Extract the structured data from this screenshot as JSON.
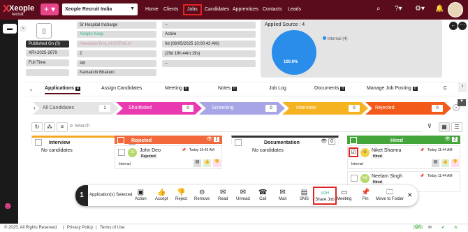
{
  "header": {
    "brand": "Xeople",
    "brand_sub": "recruit",
    "org": "Xeople Recruit India",
    "nav": [
      "Home",
      "Clients",
      "Jobs",
      "Candidates",
      "Apprentices",
      "Contacts",
      "Leads"
    ],
    "active_nav": "Jobs"
  },
  "job": {
    "published": "Published On (0)",
    "job_id": "XRI-2025-2679",
    "type": "Full Time",
    "fields_mid": [
      "Sr Hospital Incharge",
      "Xeople Keep",
      "Newstate/Test, AUSTRALIA",
      "2",
      "AB",
      "Kamakshi Bhakuni"
    ],
    "fields_right": [
      "--",
      "Active",
      "0d (08/05/2025 10:00:43 AM)",
      "(29d 19h:44m:19s)",
      "--"
    ]
  },
  "chart": {
    "title": "Applied Source : 4",
    "legend": "Internal (4)",
    "value_label": "100.0%"
  },
  "tabs": [
    {
      "label": "Applications",
      "badge": "4"
    },
    {
      "label": "Assign Candidates"
    },
    {
      "label": "Meeting",
      "badge": "0"
    },
    {
      "label": "Notes",
      "badge": "0"
    },
    {
      "label": "Job Log"
    },
    {
      "label": "Documents",
      "badge": "0"
    },
    {
      "label": "Manage Job Posting",
      "badge": "0"
    },
    {
      "label": "C"
    }
  ],
  "stages": [
    {
      "label": "All Candidates",
      "count": "1",
      "color": "#e5e5e5",
      "text": "#555"
    },
    {
      "label": "Shortlisted",
      "count": "0",
      "color": "#ea3ab2",
      "text": "#fff"
    },
    {
      "label": "Screening",
      "count": "0",
      "color": "#a7a5e6",
      "text": "#fff"
    },
    {
      "label": "Interview",
      "count": "0",
      "color": "#f5b322",
      "text": "#fff"
    },
    {
      "label": "Rejected",
      "count": "0",
      "color": "#f25a19",
      "text": "#fff"
    }
  ],
  "search": {
    "placeholder": "Search"
  },
  "columns": [
    {
      "title": "Interview",
      "count": "0",
      "color": "#f5a623",
      "empty": "No candidates"
    },
    {
      "title": "Rejected",
      "count": "1",
      "color": "#f1693b",
      "cards": [
        {
          "initials": "JD",
          "name": "John Deo",
          "time": "Today 10:45 AM",
          "status": "Rejected",
          "source": "Internal"
        }
      ]
    },
    {
      "title": "Documentation",
      "count": "0",
      "color": "#333",
      "empty": "No candidates"
    },
    {
      "title": "Hired",
      "count": "2",
      "color": "#43a53a",
      "cards": [
        {
          "initials": "",
          "name": "Niket Sharma",
          "time": "Today 11:44 AM",
          "status": "Hired",
          "source": "Internal"
        },
        {
          "initials": "NS",
          "name": "Neelam Singh",
          "time": "Today 11:44 AM",
          "status": "Hired",
          "source": "Internal"
        }
      ]
    }
  ],
  "bulk": {
    "count": "1",
    "label": "Application(s) Selected",
    "actions": [
      "Action",
      "Accept",
      "Reject",
      "Remove",
      "Read",
      "Unread",
      "Call",
      "Mail",
      "SMS",
      "Share Job",
      "Meeting",
      "Pin",
      "Move to Folder"
    ]
  },
  "footer": {
    "copyright": "© 2025. All Rights Reserved",
    "privacy": "Privacy Policy",
    "terms": "Terms of Use",
    "qa": "QA"
  }
}
